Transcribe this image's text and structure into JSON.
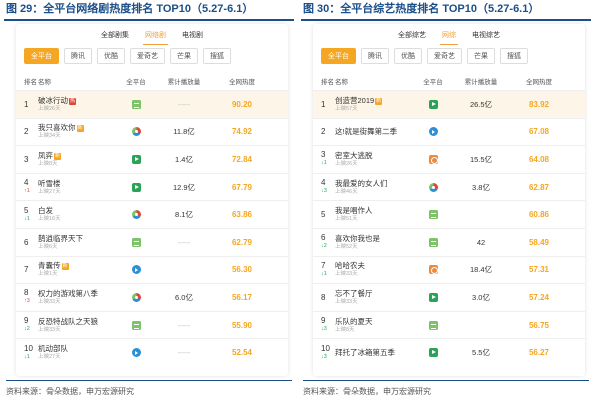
{
  "left": {
    "title": "图 29：全平台网络剧热度排名 TOP10（5.27-6.1）",
    "main_tabs": [
      {
        "label": "全部剧集",
        "active": false
      },
      {
        "label": "网络剧",
        "active": true
      },
      {
        "label": "电视剧",
        "active": false
      }
    ],
    "filters": [
      {
        "label": "全平台",
        "active": true
      },
      {
        "label": "腾讯",
        "active": false
      },
      {
        "label": "优酷",
        "active": false
      },
      {
        "label": "爱奇艺",
        "active": false
      },
      {
        "label": "芒果",
        "active": false
      },
      {
        "label": "搜狐",
        "active": false
      }
    ],
    "headers": {
      "rank": "排名",
      "name": "名称",
      "platform": "全平台",
      "count": "累计播放量",
      "heat": "全网热度"
    },
    "rows": [
      {
        "rank": "1",
        "change": "",
        "name": "破冰行动",
        "badge": "热",
        "sub": "上映26天",
        "platform_icon": "tv-icon",
        "count": "-----",
        "heat": "90.20"
      },
      {
        "rank": "2",
        "change": "",
        "name": "我只喜欢你",
        "badge": "新",
        "sub": "上映34天",
        "platform_icon": "multi-icon",
        "count": "11.8亿",
        "heat": "74.92"
      },
      {
        "rank": "3",
        "change": "",
        "name": "凤弈",
        "badge": "新",
        "sub": "上映8天",
        "platform_icon": "iqiyi-icon",
        "count": "1.4亿",
        "heat": "72.84"
      },
      {
        "rank": "4",
        "change": "↑1",
        "name": "听雪楼",
        "badge": "",
        "sub": "上映27天",
        "platform_icon": "iqiyi-icon",
        "count": "12.9亿",
        "heat": "67.79"
      },
      {
        "rank": "5",
        "change": "↓1",
        "name": "白发",
        "badge": "",
        "sub": "上映16天",
        "platform_icon": "multi-icon",
        "count": "8.1亿",
        "heat": "63.86"
      },
      {
        "rank": "6",
        "change": "",
        "name": "鹊逍临界天下",
        "badge": "",
        "sub": "上映6天",
        "platform_icon": "tv-icon",
        "count": "-----",
        "heat": "62.79"
      },
      {
        "rank": "7",
        "change": "",
        "name": "青囊传",
        "badge": "新",
        "sub": "上映1天",
        "platform_icon": "play-icon",
        "count": "",
        "heat": "56.30"
      },
      {
        "rank": "8",
        "change": "↑3",
        "name": "权力的游戏第八季",
        "badge": "",
        "sub": "上映33天",
        "platform_icon": "multi-icon",
        "count": "6.0亿",
        "heat": "56.17"
      },
      {
        "rank": "9",
        "change": "↓2",
        "name": "反恐特战队之天狼",
        "badge": "",
        "sub": "上映33天",
        "platform_icon": "tv-icon",
        "count": "-----",
        "heat": "55.90"
      },
      {
        "rank": "10",
        "change": "↓1",
        "name": "机动部队",
        "badge": "",
        "sub": "上映27天",
        "platform_icon": "play-icon",
        "count": "-----",
        "heat": "52.54"
      }
    ],
    "source": "资料来源：骨朵数据，申万宏源研究"
  },
  "right": {
    "title": "图 30：全平台综艺热度排名 TOP10（5.27-6.1）",
    "main_tabs": [
      {
        "label": "全部综艺",
        "active": false
      },
      {
        "label": "网综",
        "active": true
      },
      {
        "label": "电视综艺",
        "active": false
      }
    ],
    "filters": [
      {
        "label": "全平台",
        "active": true
      },
      {
        "label": "腾讯",
        "active": false
      },
      {
        "label": "优酷",
        "active": false
      },
      {
        "label": "爱奇艺",
        "active": false
      },
      {
        "label": "芒果",
        "active": false
      },
      {
        "label": "搜狐",
        "active": false
      }
    ],
    "headers": {
      "rank": "排名",
      "name": "名称",
      "platform": "全平台",
      "count": "累计播放量",
      "heat": "全网热度"
    },
    "rows": [
      {
        "rank": "1",
        "change": "",
        "name": "创造营2019",
        "badge": "新",
        "sub": "上映57天",
        "platform_icon": "iqiyi-icon",
        "count": "26.5亿",
        "heat": "83.92"
      },
      {
        "rank": "2",
        "change": "",
        "name": "这!就是街舞第二季",
        "badge": "",
        "sub": "",
        "platform_icon": "play-icon",
        "count": "",
        "heat": "67.08"
      },
      {
        "rank": "3",
        "change": "↓1",
        "name": "密室大逃脱",
        "badge": "",
        "sub": "上映26天",
        "platform_icon": "mango-icon",
        "count": "15.5亿",
        "heat": "64.08"
      },
      {
        "rank": "4",
        "change": "↓3",
        "name": "我最爱的女人们",
        "badge": "",
        "sub": "上映46天",
        "platform_icon": "multi-icon",
        "count": "3.8亿",
        "heat": "62.87"
      },
      {
        "rank": "5",
        "change": "",
        "name": "我是唱作人",
        "badge": "",
        "sub": "上映51天",
        "platform_icon": "tv-icon",
        "count": "",
        "heat": "60.86"
      },
      {
        "rank": "6",
        "change": "↓2",
        "name": "喜欢你我也是",
        "badge": "",
        "sub": "上映52天",
        "platform_icon": "tv-icon",
        "count": "42",
        "heat": "58.49"
      },
      {
        "rank": "7",
        "change": "↓1",
        "name": "哈哈农夫",
        "badge": "",
        "sub": "上映33天",
        "platform_icon": "mango-icon",
        "count": "18.4亿",
        "heat": "57.31"
      },
      {
        "rank": "8",
        "change": "",
        "name": "忘不了餐厅",
        "badge": "",
        "sub": "上映33天",
        "platform_icon": "iqiyi-icon",
        "count": "3.0亿",
        "heat": "57.24"
      },
      {
        "rank": "9",
        "change": "↓3",
        "name": "乐队的夏天",
        "badge": "",
        "sub": "上映8天",
        "platform_icon": "tv-icon",
        "count": "",
        "heat": "56.75"
      },
      {
        "rank": "10",
        "change": "↓3",
        "name": "拜托了冰箱第五季",
        "badge": "",
        "sub": "",
        "platform_icon": "iqiyi-icon",
        "count": "5.5亿",
        "heat": "56.27"
      }
    ],
    "source": "资料来源：骨朵数据，申万宏源研究"
  }
}
